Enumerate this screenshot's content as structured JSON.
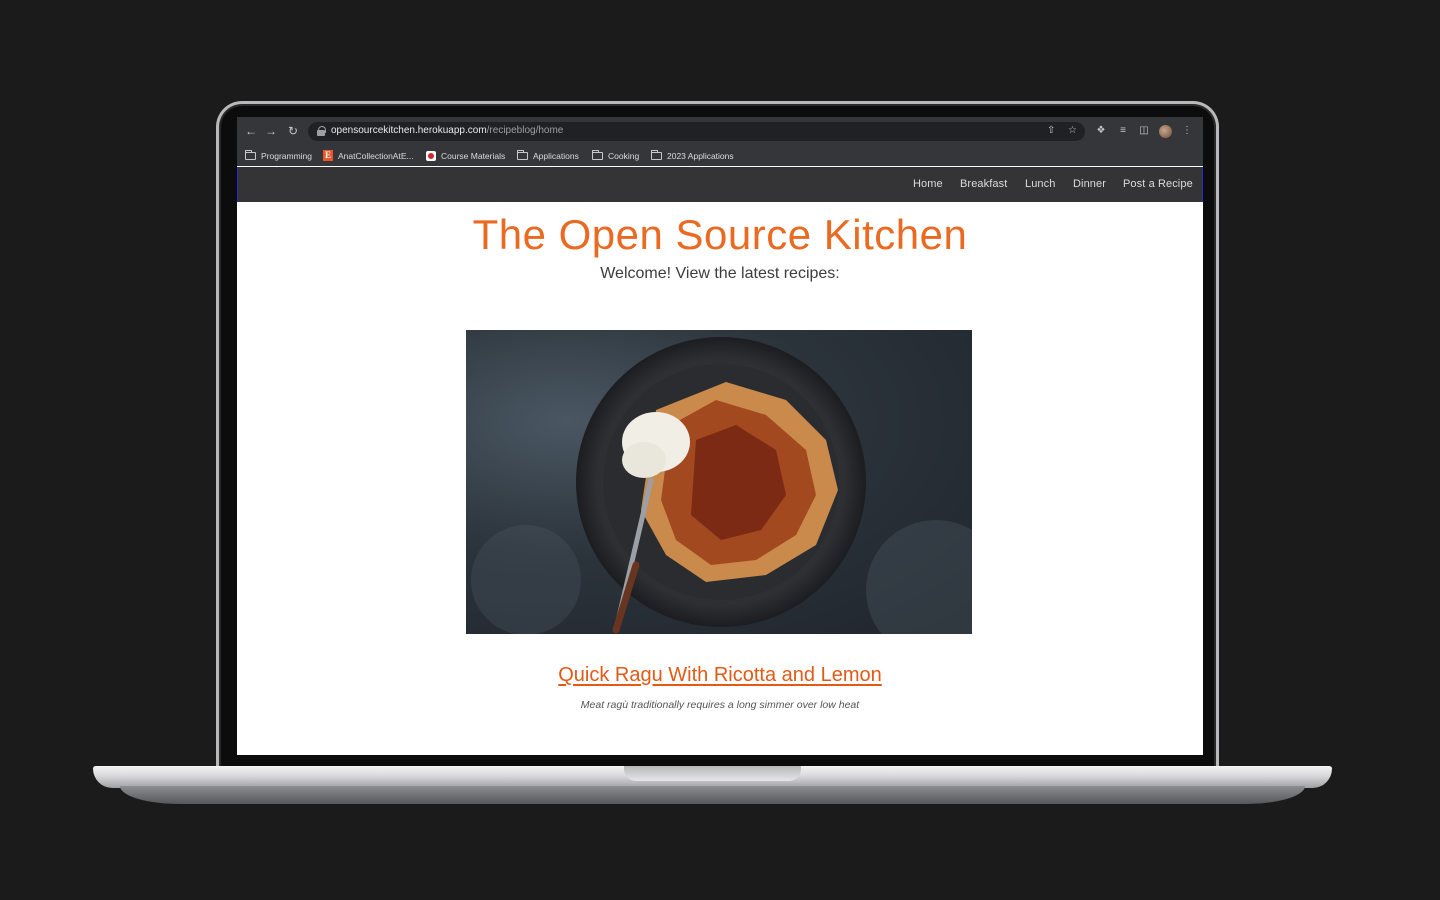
{
  "browser": {
    "url_host": "opensourcekitchen.herokuapp.com",
    "url_path": "/recipeblog/home",
    "bookmarks": [
      {
        "label": "Programming",
        "icon": "folder-icon"
      },
      {
        "label": "AnatCollectionAtE...",
        "icon": "etsy-icon"
      },
      {
        "label": "Course Materials",
        "icon": "course-icon"
      },
      {
        "label": "Applications",
        "icon": "folder-icon"
      },
      {
        "label": "Cooking",
        "icon": "folder-icon"
      },
      {
        "label": "2023 Applications",
        "icon": "folder-icon"
      }
    ]
  },
  "site": {
    "nav": [
      "Home",
      "Breakfast",
      "Lunch",
      "Dinner",
      "Post a Recipe"
    ],
    "title": "The Open Source Kitchen",
    "welcome": "Welcome! View the latest recipes:",
    "recipe": {
      "title": "Quick Ragu With Ricotta and Lemon",
      "description": "Meat ragù traditionally requires a long simmer over low heat"
    }
  },
  "colors": {
    "accent": "#ea6a22",
    "nav_bg": "#343436",
    "page_bg": "#1b1b1b"
  }
}
